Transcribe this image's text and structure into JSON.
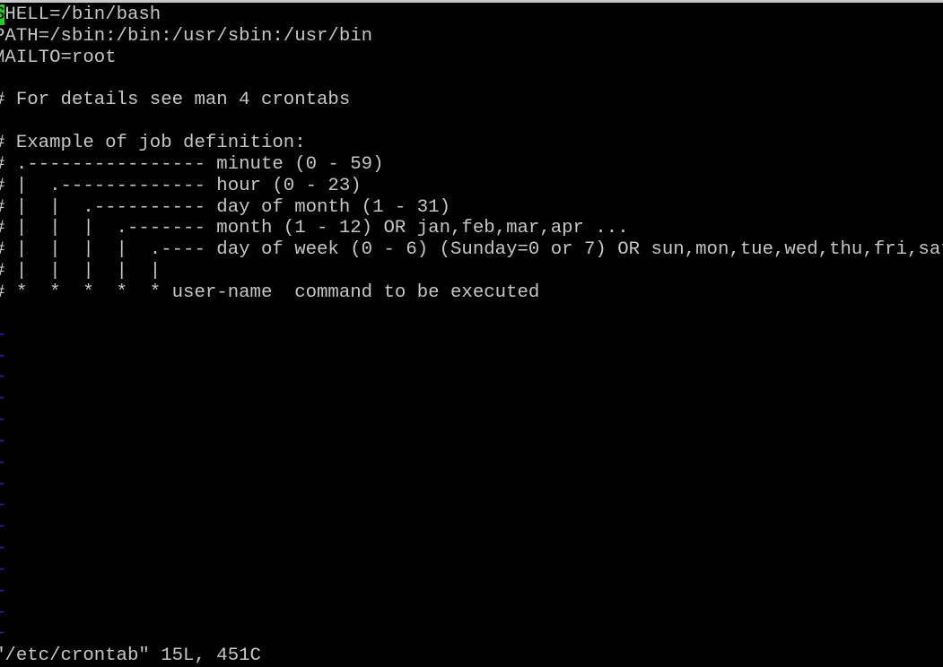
{
  "editor": {
    "cursor_char": "S",
    "lines": [
      "HELL=/bin/bash",
      "PATH=/sbin:/bin:/usr/sbin:/usr/bin",
      "MAILTO=root",
      "",
      "# For details see man 4 crontabs",
      "",
      "# Example of job definition:",
      "# .---------------- minute (0 - 59)",
      "# |  .------------- hour (0 - 23)",
      "# |  |  .---------- day of month (1 - 31)",
      "# |  |  |  .------- month (1 - 12) OR jan,feb,mar,apr ...",
      "# |  |  |  |  .---- day of week (0 - 6) (Sunday=0 or 7) OR sun,mon,tue,wed,thu,fri,sat",
      "# |  |  |  |  |",
      "# *  *  *  *  * user-name  command to be executed",
      ""
    ],
    "empty_line_marker": "~",
    "empty_line_count": 15,
    "status_line": "\"/etc/crontab\" 15L, 451C",
    "colors": {
      "text": "#c6c6c6",
      "tilde": "#2a24b8",
      "cursor": "#1fd01f",
      "background": "#000000"
    }
  }
}
